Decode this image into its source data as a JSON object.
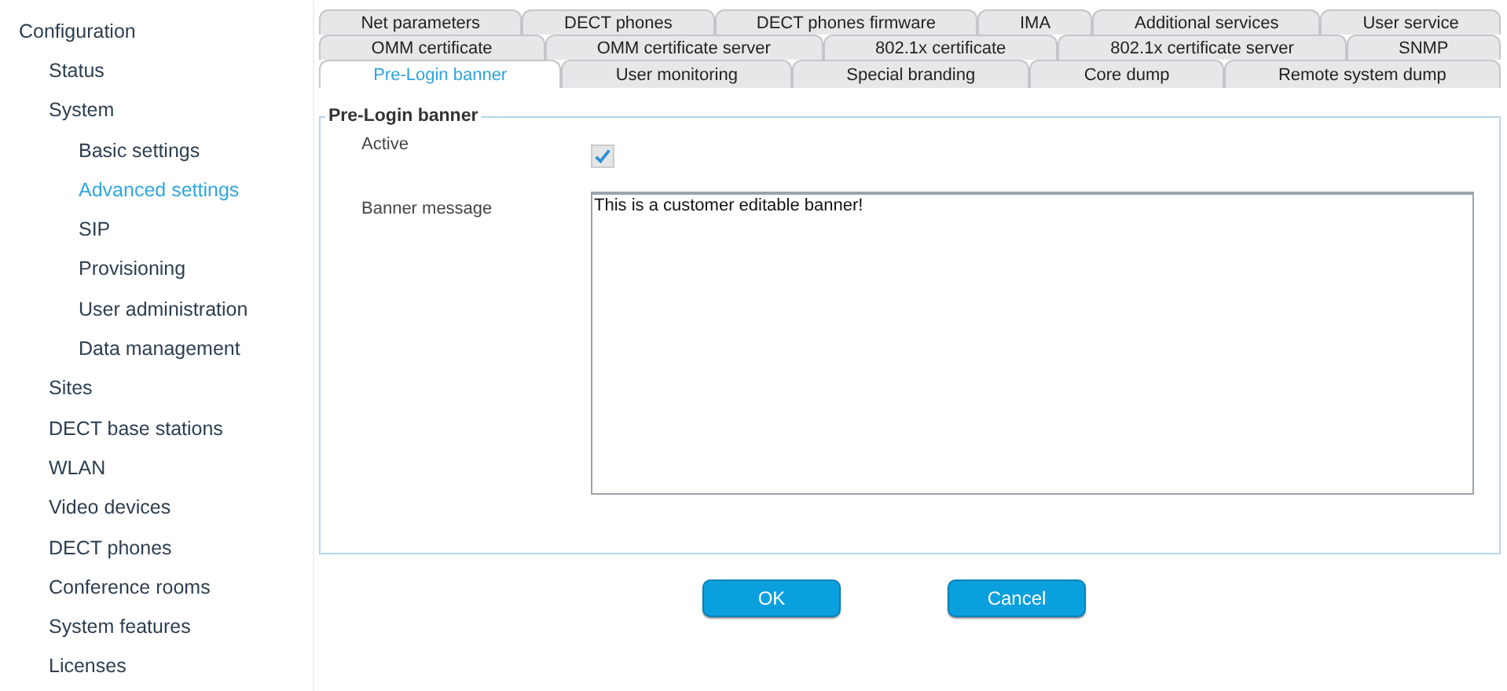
{
  "sidebar": {
    "items": [
      {
        "label": "Configuration",
        "selected": false,
        "children": [
          {
            "label": "Status",
            "selected": false
          },
          {
            "label": "System",
            "selected": false,
            "children": [
              {
                "label": "Basic settings",
                "selected": false
              },
              {
                "label": "Advanced settings",
                "selected": true
              },
              {
                "label": "SIP",
                "selected": false
              },
              {
                "label": "Provisioning",
                "selected": false
              },
              {
                "label": "User administration",
                "selected": false
              },
              {
                "label": "Data management",
                "selected": false
              }
            ]
          },
          {
            "label": "Sites",
            "selected": false
          },
          {
            "label": "DECT base stations",
            "selected": false
          },
          {
            "label": "WLAN",
            "selected": false
          },
          {
            "label": "Video devices",
            "selected": false
          },
          {
            "label": "DECT phones",
            "selected": false
          },
          {
            "label": "Conference rooms",
            "selected": false
          },
          {
            "label": "System features",
            "selected": false
          },
          {
            "label": "Licenses",
            "selected": false
          }
        ]
      }
    ]
  },
  "tab_rows": [
    [
      {
        "label": "Net parameters",
        "selected": false
      },
      {
        "label": "DECT phones",
        "selected": false
      },
      {
        "label": "DECT phones firmware",
        "selected": false
      },
      {
        "label": "IMA",
        "selected": false
      },
      {
        "label": "Additional services",
        "selected": false
      },
      {
        "label": "User service",
        "selected": false
      }
    ],
    [
      {
        "label": "OMM certificate",
        "selected": false
      },
      {
        "label": "OMM certificate server",
        "selected": false
      },
      {
        "label": "802.1x certificate",
        "selected": false
      },
      {
        "label": "802.1x certificate server",
        "selected": false
      },
      {
        "label": "SNMP",
        "selected": false
      }
    ],
    [
      {
        "label": "Pre-Login banner",
        "selected": true
      },
      {
        "label": "User monitoring",
        "selected": false
      },
      {
        "label": "Special branding",
        "selected": false
      },
      {
        "label": "Core dump",
        "selected": false
      },
      {
        "label": "Remote system dump",
        "selected": false
      }
    ]
  ],
  "panel": {
    "title": "Pre-Login banner",
    "active": {
      "label": "Active",
      "checked": true
    },
    "banner_message": {
      "label": "Banner message",
      "value": "This is a customer editable banner!"
    }
  },
  "buttons": [
    "OK",
    "Cancel"
  ]
}
